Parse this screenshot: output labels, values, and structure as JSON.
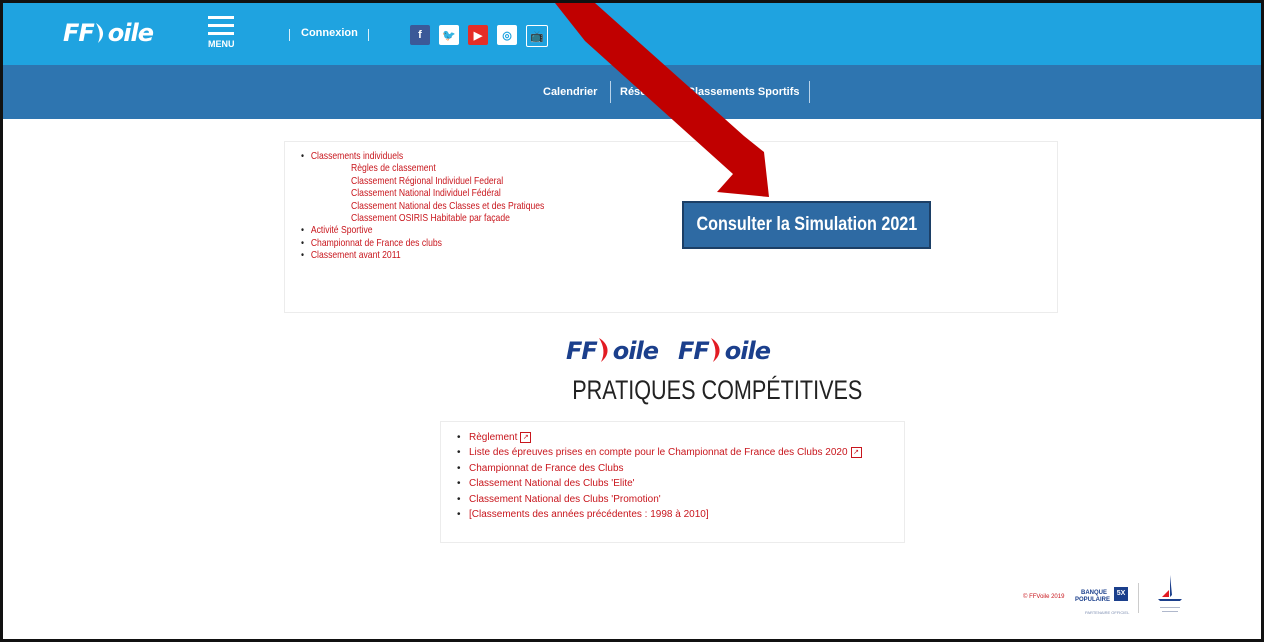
{
  "header": {
    "logo_ff": "FF",
    "logo_rest": "oile",
    "menu_label": "MENU",
    "connexion": "Connexion",
    "social": [
      {
        "icon": "facebook-icon",
        "glyph": "f",
        "bg": "#3b5998"
      },
      {
        "icon": "twitter-icon",
        "glyph": "🐦",
        "bg": "#ffffff"
      },
      {
        "icon": "youtube-icon",
        "glyph": "▶",
        "bg": "#e52d27"
      },
      {
        "icon": "instagram-icon",
        "glyph": "◎",
        "bg": "#ffffff"
      },
      {
        "icon": "tv-icon",
        "glyph": "📺",
        "bg": "#1fa3e0"
      }
    ]
  },
  "nav": {
    "calendrier": "Calendrier",
    "resultats": "Résultats",
    "classements": "Classements Sportifs"
  },
  "panel1": {
    "items": [
      {
        "label": "Classements individuels",
        "level": 0
      },
      {
        "label": "Règles de classement",
        "level": 1
      },
      {
        "label": "Classement Régional Individuel Federal",
        "level": 1
      },
      {
        "label": "Classement National Individuel Fédéral",
        "level": 1
      },
      {
        "label": "Classement National des Classes et des Pratiques",
        "level": 1
      },
      {
        "label": "Classement OSIRIS Habitable par façade",
        "level": 1
      },
      {
        "label": "Activité Sportive",
        "level": 0
      },
      {
        "label": "Championnat de France des clubs",
        "level": 0
      },
      {
        "label": "Classement avant 2011",
        "level": 0
      }
    ],
    "button": "Consulter la Simulation 2021"
  },
  "section2": {
    "logo_ff": "FF",
    "logo_rest": "oile",
    "title": "PRATIQUES COMPÉTITIVES",
    "items": [
      {
        "label": "Règlement",
        "pdf": true
      },
      {
        "label": "Liste des épreuves prises en compte pour le Championnat de France des Clubs 2020",
        "pdf": true
      },
      {
        "label": "Championnat de France des Clubs",
        "pdf": false
      },
      {
        "label": "Classement National des Clubs 'Elite'",
        "pdf": false
      },
      {
        "label": "Classement National des Clubs 'Promotion'",
        "pdf": false
      },
      {
        "label": "[Classements des années précédentes : 1998 à 2010]",
        "pdf": false
      }
    ]
  },
  "footer": {
    "copyright": "© FFVoile 2019",
    "bp_line1": "BANQUE",
    "bp_line2": "POPULAIRE",
    "bp_box": "5X",
    "bp_sub": "PARTENAIRE OFFICIEL"
  },
  "colors": {
    "topbar": "#1fa3e0",
    "navbar": "#2e75b0",
    "link_red": "#c8161d",
    "arrow": "#c00000"
  }
}
